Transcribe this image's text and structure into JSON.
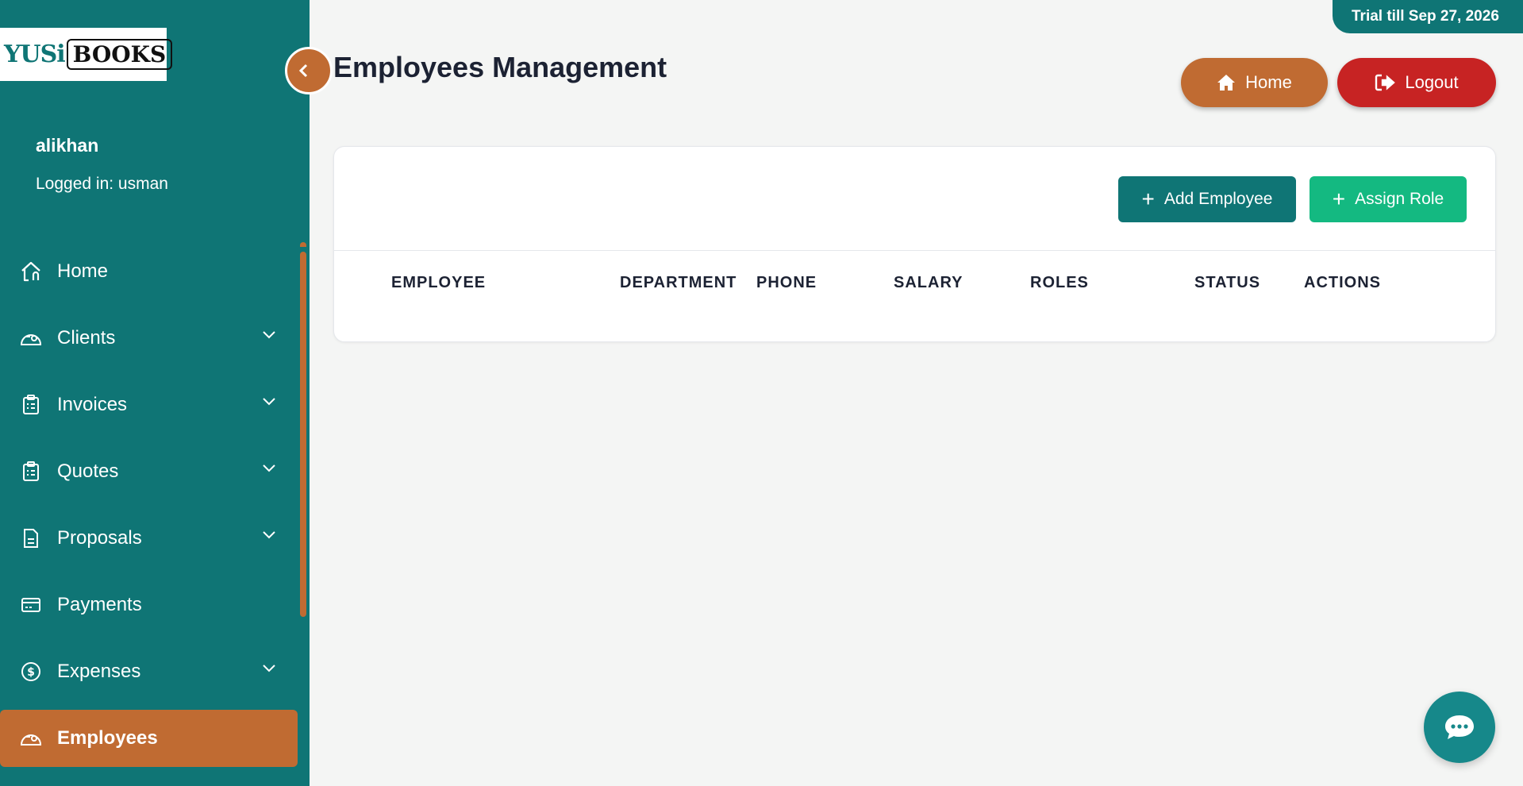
{
  "brand": {
    "logo_part1": "YUSi",
    "logo_part2": "BOOKS"
  },
  "user": {
    "name": "alikhan",
    "logged_in": "Logged in: usman"
  },
  "sidebar": {
    "items": [
      {
        "label": "Home",
        "icon": "home-icon",
        "has_submenu": false
      },
      {
        "label": "Clients",
        "icon": "clients-icon",
        "has_submenu": true
      },
      {
        "label": "Invoices",
        "icon": "clipboard-icon",
        "has_submenu": true
      },
      {
        "label": "Quotes",
        "icon": "clipboard-icon",
        "has_submenu": true
      },
      {
        "label": "Proposals",
        "icon": "document-icon",
        "has_submenu": true
      },
      {
        "label": "Payments",
        "icon": "card-icon",
        "has_submenu": false
      },
      {
        "label": "Expenses",
        "icon": "dollar-icon",
        "has_submenu": true
      },
      {
        "label": "Employees",
        "icon": "employees-icon",
        "has_submenu": false,
        "active": true
      }
    ]
  },
  "header": {
    "trial": "Trial till Sep 27, 2026",
    "title": "Employees Management",
    "home_label": "Home",
    "logout_label": "Logout"
  },
  "toolbar": {
    "add_employee": "Add Employee",
    "assign_role": "Assign Role"
  },
  "table": {
    "columns": [
      "EMPLOYEE",
      "DEPARTMENT",
      "PHONE",
      "SALARY",
      "ROLES",
      "STATUS",
      "ACTIONS"
    ],
    "rows": []
  },
  "colors": {
    "sidebar": "#0f7575",
    "accent_orange": "#c06b32",
    "logout_red": "#c72323",
    "assign_green": "#14b981"
  }
}
